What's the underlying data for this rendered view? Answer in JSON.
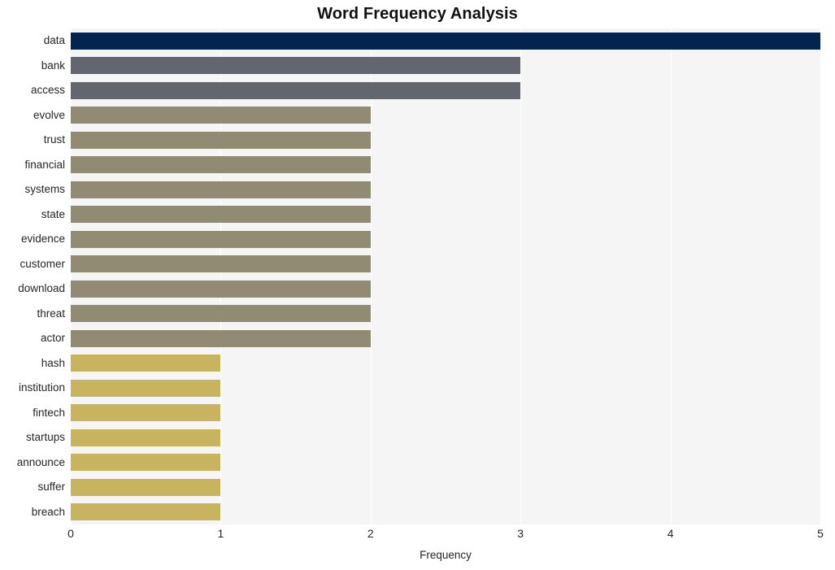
{
  "chart_data": {
    "type": "bar",
    "orientation": "horizontal",
    "title": "Word Frequency Analysis",
    "xlabel": "Frequency",
    "ylabel": "",
    "xlim": [
      0,
      5
    ],
    "xticks": [
      0,
      1,
      2,
      3,
      4,
      5
    ],
    "xtick_labels": [
      "0",
      "1",
      "2",
      "3",
      "4",
      "5"
    ],
    "grid": true,
    "grid_axis": "x",
    "legend": null,
    "categories": [
      "data",
      "bank",
      "access",
      "evolve",
      "trust",
      "financial",
      "systems",
      "state",
      "evidence",
      "customer",
      "download",
      "threat",
      "actor",
      "hash",
      "institution",
      "fintech",
      "startups",
      "announce",
      "suffer",
      "breach"
    ],
    "values": [
      5,
      3,
      3,
      2,
      2,
      2,
      2,
      2,
      2,
      2,
      2,
      2,
      2,
      1,
      1,
      1,
      1,
      1,
      1,
      1
    ],
    "bar_colors": [
      "#0a2murk",
      "#63666e",
      "#63666e",
      "#918b74",
      "#918b74",
      "#918b74",
      "#918b74",
      "#918b74",
      "#918b74",
      "#918b74",
      "#918b74",
      "#918b74",
      "#918b74",
      "#c8b45f",
      "#c8b45f",
      "#c8b45f",
      "#c8b45f",
      "#c8b45f",
      "#c8b45f",
      "#c8b45f"
    ]
  },
  "palette": {
    "value_5": "#042450",
    "value_3": "#63666e",
    "value_2": "#918b74",
    "value_1": "#c8b45f",
    "plot_background": "#f5f5f6",
    "figure_background": "#ffffff",
    "gridline": "#ffffff",
    "text": "#262626",
    "title_text": "#111111"
  }
}
